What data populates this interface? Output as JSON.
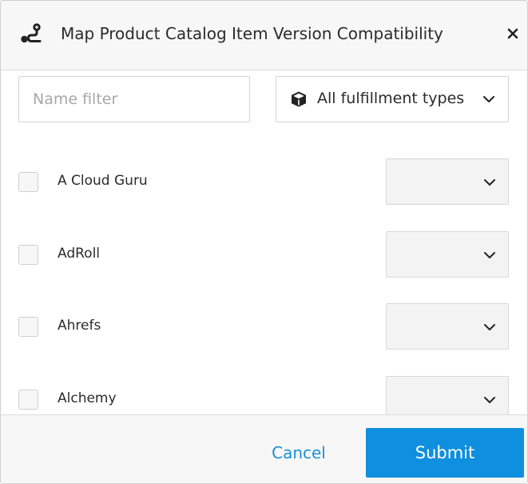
{
  "dialog": {
    "title": "Map Product Catalog Item Version Compatibility",
    "header_icon": "route-icon",
    "close_icon": "close-icon"
  },
  "filters": {
    "name_placeholder": "Name filter",
    "name_value": "",
    "fulfillment_type_selected": "All fulfillment types",
    "fulfillment_type_icon": "box-icon"
  },
  "items": [
    {
      "name": "A Cloud Guru",
      "checked": false,
      "version": ""
    },
    {
      "name": "AdRoll",
      "checked": false,
      "version": ""
    },
    {
      "name": "Ahrefs",
      "checked": false,
      "version": ""
    },
    {
      "name": "Alchemy",
      "checked": false,
      "version": ""
    }
  ],
  "footer": {
    "cancel_label": "Cancel",
    "submit_label": "Submit"
  },
  "colors": {
    "accent": "#0f8fdf",
    "link": "#1a8fd6",
    "header_bg": "#f7f7f7"
  }
}
